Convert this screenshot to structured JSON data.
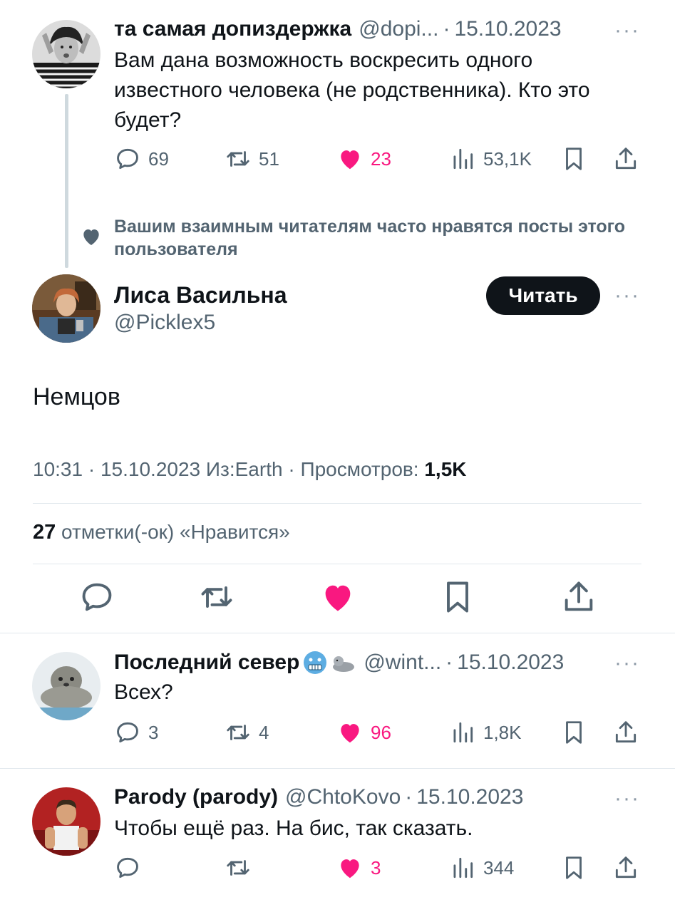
{
  "colors": {
    "text": "#0f1419",
    "muted": "#536471",
    "like": "#f91880",
    "divider": "#e1e8ed"
  },
  "parent_tweet": {
    "name": "та самая допиздержка",
    "handle": "@dopi...",
    "separator": "·",
    "date": "15.10.2023",
    "more": "···",
    "text": "Вам дана возможность воскресить одного известного человека (не родственника). Кто это будет?",
    "replies": "69",
    "retweets": "51",
    "likes": "23",
    "views": "53,1K",
    "icons": [
      "reply-icon",
      "retweet-icon",
      "heart-icon",
      "views-icon",
      "bookmark-icon",
      "share-icon"
    ]
  },
  "social_context": {
    "text": "Вашим взаимным читателям часто нравятся посты этого пользователя",
    "icon": "heart-icon"
  },
  "main_tweet": {
    "name": "Лиса Васильна",
    "handle": "@Picklex5",
    "follow_label": "Читать",
    "more": "···",
    "text": "Немцов",
    "time": "10:31",
    "date": "15.10.2023",
    "source": "Из:Earth",
    "views_label": "Просмотров:",
    "views": "1,5K",
    "sep": "·",
    "likes_count": "27",
    "likes_label": "отметки(-ок) «Нравится»"
  },
  "replies": [
    {
      "name": "Последний север",
      "handle": "@wint...",
      "separator": "·",
      "date": "15.10.2023",
      "more": "···",
      "text": "Всех?",
      "replies": "3",
      "retweets": "4",
      "likes": "96",
      "views": "1,8K",
      "emojis": [
        "cold-face-emoji",
        "seal-emoji"
      ]
    },
    {
      "name": "Parody (parody)",
      "handle": "@ChtoKovo",
      "separator": "·",
      "date": "15.10.2023",
      "more": "···",
      "text": "Чтобы ещё раз. На бис, так сказать.",
      "replies": "",
      "retweets": "",
      "likes": "3",
      "views": "344"
    }
  ]
}
